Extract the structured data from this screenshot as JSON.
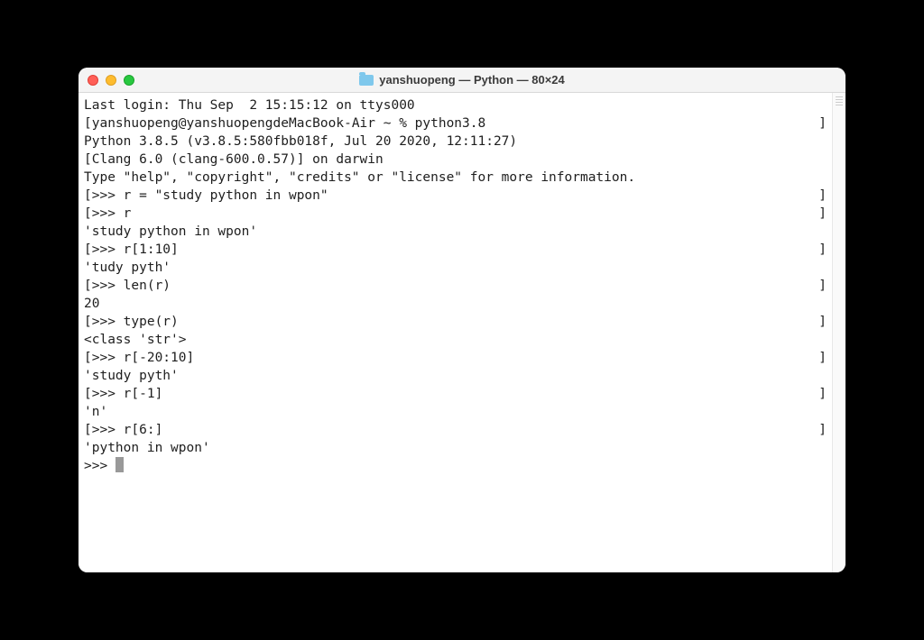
{
  "window": {
    "title": "yanshuopeng — Python — 80×24"
  },
  "terminal": {
    "lines": [
      {
        "type": "plain",
        "text": "Last login: Thu Sep  2 15:15:12 on ttys000"
      },
      {
        "type": "bracket",
        "text": "yanshuopeng@yanshuopengdeMacBook-Air ~ % python3.8"
      },
      {
        "type": "plain",
        "text": "Python 3.8.5 (v3.8.5:580fbb018f, Jul 20 2020, 12:11:27)"
      },
      {
        "type": "plain",
        "text": "[Clang 6.0 (clang-600.0.57)] on darwin"
      },
      {
        "type": "plain",
        "text": "Type \"help\", \"copyright\", \"credits\" or \"license\" for more information."
      },
      {
        "type": "bracket",
        "text": ">>> r = \"study python in wpon\""
      },
      {
        "type": "bracket",
        "text": ">>> r"
      },
      {
        "type": "plain",
        "text": "'study python in wpon'"
      },
      {
        "type": "bracket",
        "text": ">>> r[1:10]"
      },
      {
        "type": "plain",
        "text": "'tudy pyth'"
      },
      {
        "type": "bracket",
        "text": ">>> len(r)"
      },
      {
        "type": "plain",
        "text": "20"
      },
      {
        "type": "bracket",
        "text": ">>> type(r)"
      },
      {
        "type": "plain",
        "text": "<class 'str'>"
      },
      {
        "type": "bracket",
        "text": ">>> r[-20:10]"
      },
      {
        "type": "plain",
        "text": "'study pyth'"
      },
      {
        "type": "bracket",
        "text": ">>> r[-1]"
      },
      {
        "type": "plain",
        "text": "'n'"
      },
      {
        "type": "bracket",
        "text": ">>> r[6:]"
      },
      {
        "type": "plain",
        "text": "'python in wpon'"
      },
      {
        "type": "cursor",
        "text": ">>> "
      }
    ]
  }
}
